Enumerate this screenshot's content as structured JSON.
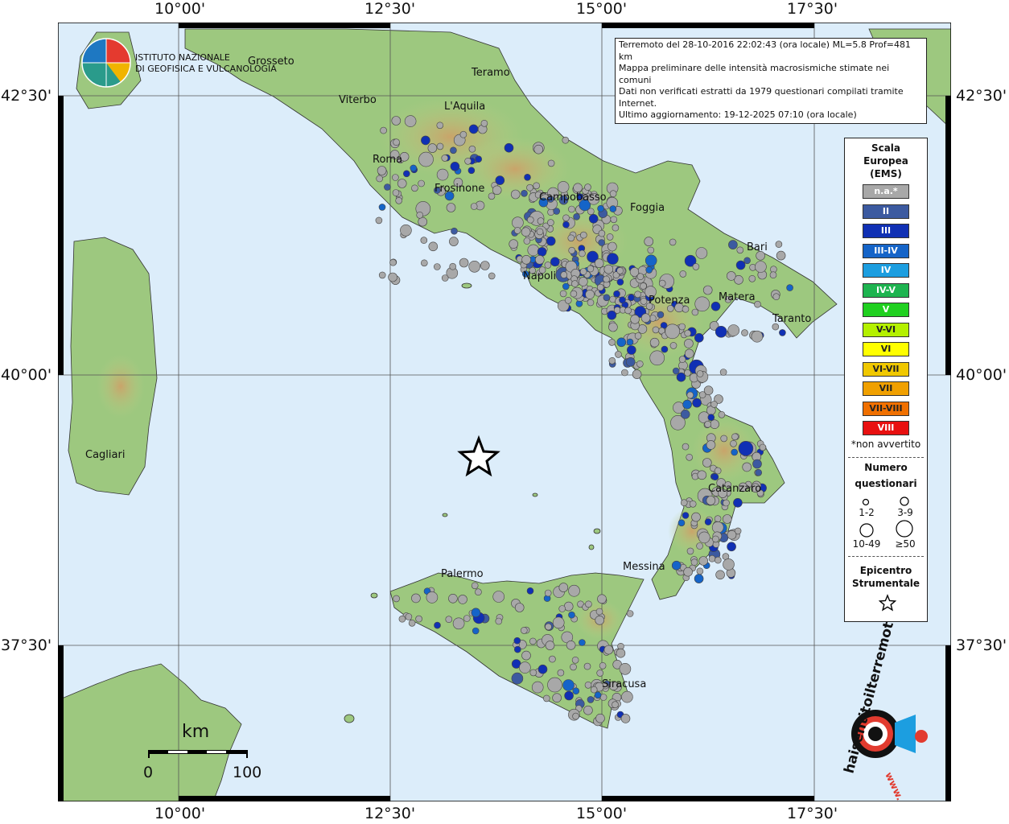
{
  "header": {
    "lines": [
      "Terremoto del 28-10-2016 22:02:43 (ora locale) ML=5.8 Prof=481 km",
      "Mappa preliminare delle intensità macrosismiche stimate nei comuni",
      "Dati non verificati estratti da 1979 questionari compilati tramite Internet.",
      "Ultimo aggiornamento: 19-12-2025 07:10 (ora locale)"
    ]
  },
  "logo": {
    "line1": "ISTITUTO NAZIONALE",
    "line2": "DI GEOFISICA E VULCANOLOGIA"
  },
  "axes": {
    "lon_labels": [
      "10°00'",
      "12°30'",
      "15°00'",
      "17°30'"
    ],
    "lat_labels": [
      "42°30'",
      "40°00'",
      "37°30'"
    ]
  },
  "cities": [
    {
      "name": "Grosseto"
    },
    {
      "name": "Teramo"
    },
    {
      "name": "Viterbo"
    },
    {
      "name": "L'Aquila"
    },
    {
      "name": "Roma"
    },
    {
      "name": "Frosinone"
    },
    {
      "name": "Campobasso"
    },
    {
      "name": "Foggia"
    },
    {
      "name": "Bari"
    },
    {
      "name": "Napoli"
    },
    {
      "name": "Potenza"
    },
    {
      "name": "Matera"
    },
    {
      "name": "Taranto"
    },
    {
      "name": "Cagliari"
    },
    {
      "name": "Catanzaro"
    },
    {
      "name": "Palermo"
    },
    {
      "name": "Messina"
    },
    {
      "name": "Siracusa"
    }
  ],
  "legend": {
    "title": [
      "Scala",
      "Europea",
      "(EMS)"
    ],
    "items": [
      {
        "label": "n.a.*",
        "color": "#a8a8a8"
      },
      {
        "label": "II",
        "color": "#3c5aa0"
      },
      {
        "label": "III",
        "color": "#1030b4"
      },
      {
        "label": "III-IV",
        "color": "#1564c8"
      },
      {
        "label": "IV",
        "color": "#1c9ee0"
      },
      {
        "label": "IV-V",
        "color": "#1eb450"
      },
      {
        "label": "V",
        "color": "#20d020"
      },
      {
        "label": "V-VI",
        "color": "#b4f000"
      },
      {
        "label": "VI",
        "color": "#ffff00"
      },
      {
        "label": "VI-VII",
        "color": "#f0c800"
      },
      {
        "label": "VII",
        "color": "#f0a000"
      },
      {
        "label": "VII-VIII",
        "color": "#f07000"
      },
      {
        "label": "VIII",
        "color": "#e81010"
      }
    ],
    "note": "*non avvertito",
    "count_title": [
      "Numero",
      "questionari"
    ],
    "counts": [
      "1-2",
      "3-9",
      "10-49",
      "≥50"
    ],
    "epicenter_title": [
      "Epicentro",
      "Strumentale"
    ]
  },
  "scale_bar": {
    "unit": "km",
    "min": "0",
    "max": "100"
  },
  "brand": {
    "text": "haisentitoilterremoto.it",
    "url_text": "www."
  },
  "epicenter": {
    "lon": 13.55,
    "lat": 39.2,
    "depth_km": 481,
    "magnitude": "ML=5.8"
  },
  "colors": {
    "sea": "#dcedfa",
    "land_low": "#93c47d",
    "land_mid": "#b7d188",
    "land_high": "#c7a36a",
    "grid": "#555555"
  }
}
